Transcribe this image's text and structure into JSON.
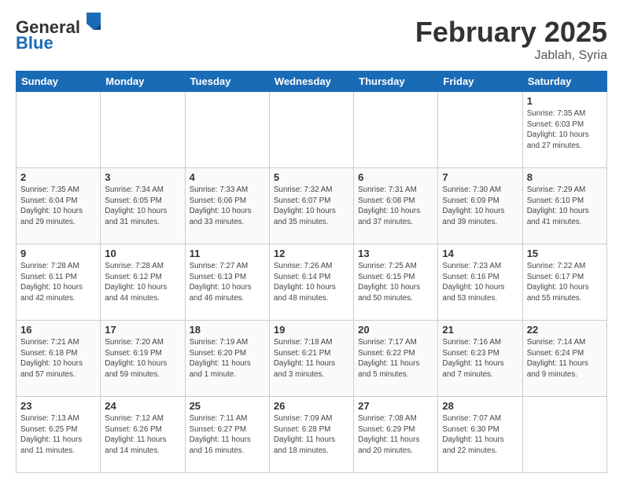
{
  "header": {
    "logo_line1": "General",
    "logo_line2": "Blue",
    "month_year": "February 2025",
    "location": "Jablah, Syria"
  },
  "days_of_week": [
    "Sunday",
    "Monday",
    "Tuesday",
    "Wednesday",
    "Thursday",
    "Friday",
    "Saturday"
  ],
  "weeks": [
    [
      {
        "day": "",
        "info": ""
      },
      {
        "day": "",
        "info": ""
      },
      {
        "day": "",
        "info": ""
      },
      {
        "day": "",
        "info": ""
      },
      {
        "day": "",
        "info": ""
      },
      {
        "day": "",
        "info": ""
      },
      {
        "day": "1",
        "info": "Sunrise: 7:35 AM\nSunset: 6:03 PM\nDaylight: 10 hours\nand 27 minutes."
      }
    ],
    [
      {
        "day": "2",
        "info": "Sunrise: 7:35 AM\nSunset: 6:04 PM\nDaylight: 10 hours\nand 29 minutes."
      },
      {
        "day": "3",
        "info": "Sunrise: 7:34 AM\nSunset: 6:05 PM\nDaylight: 10 hours\nand 31 minutes."
      },
      {
        "day": "4",
        "info": "Sunrise: 7:33 AM\nSunset: 6:06 PM\nDaylight: 10 hours\nand 33 minutes."
      },
      {
        "day": "5",
        "info": "Sunrise: 7:32 AM\nSunset: 6:07 PM\nDaylight: 10 hours\nand 35 minutes."
      },
      {
        "day": "6",
        "info": "Sunrise: 7:31 AM\nSunset: 6:08 PM\nDaylight: 10 hours\nand 37 minutes."
      },
      {
        "day": "7",
        "info": "Sunrise: 7:30 AM\nSunset: 6:09 PM\nDaylight: 10 hours\nand 39 minutes."
      },
      {
        "day": "8",
        "info": "Sunrise: 7:29 AM\nSunset: 6:10 PM\nDaylight: 10 hours\nand 41 minutes."
      }
    ],
    [
      {
        "day": "9",
        "info": "Sunrise: 7:28 AM\nSunset: 6:11 PM\nDaylight: 10 hours\nand 42 minutes."
      },
      {
        "day": "10",
        "info": "Sunrise: 7:28 AM\nSunset: 6:12 PM\nDaylight: 10 hours\nand 44 minutes."
      },
      {
        "day": "11",
        "info": "Sunrise: 7:27 AM\nSunset: 6:13 PM\nDaylight: 10 hours\nand 46 minutes."
      },
      {
        "day": "12",
        "info": "Sunrise: 7:26 AM\nSunset: 6:14 PM\nDaylight: 10 hours\nand 48 minutes."
      },
      {
        "day": "13",
        "info": "Sunrise: 7:25 AM\nSunset: 6:15 PM\nDaylight: 10 hours\nand 50 minutes."
      },
      {
        "day": "14",
        "info": "Sunrise: 7:23 AM\nSunset: 6:16 PM\nDaylight: 10 hours\nand 53 minutes."
      },
      {
        "day": "15",
        "info": "Sunrise: 7:22 AM\nSunset: 6:17 PM\nDaylight: 10 hours\nand 55 minutes."
      }
    ],
    [
      {
        "day": "16",
        "info": "Sunrise: 7:21 AM\nSunset: 6:18 PM\nDaylight: 10 hours\nand 57 minutes."
      },
      {
        "day": "17",
        "info": "Sunrise: 7:20 AM\nSunset: 6:19 PM\nDaylight: 10 hours\nand 59 minutes."
      },
      {
        "day": "18",
        "info": "Sunrise: 7:19 AM\nSunset: 6:20 PM\nDaylight: 11 hours\nand 1 minute."
      },
      {
        "day": "19",
        "info": "Sunrise: 7:18 AM\nSunset: 6:21 PM\nDaylight: 11 hours\nand 3 minutes."
      },
      {
        "day": "20",
        "info": "Sunrise: 7:17 AM\nSunset: 6:22 PM\nDaylight: 11 hours\nand 5 minutes."
      },
      {
        "day": "21",
        "info": "Sunrise: 7:16 AM\nSunset: 6:23 PM\nDaylight: 11 hours\nand 7 minutes."
      },
      {
        "day": "22",
        "info": "Sunrise: 7:14 AM\nSunset: 6:24 PM\nDaylight: 11 hours\nand 9 minutes."
      }
    ],
    [
      {
        "day": "23",
        "info": "Sunrise: 7:13 AM\nSunset: 6:25 PM\nDaylight: 11 hours\nand 11 minutes."
      },
      {
        "day": "24",
        "info": "Sunrise: 7:12 AM\nSunset: 6:26 PM\nDaylight: 11 hours\nand 14 minutes."
      },
      {
        "day": "25",
        "info": "Sunrise: 7:11 AM\nSunset: 6:27 PM\nDaylight: 11 hours\nand 16 minutes."
      },
      {
        "day": "26",
        "info": "Sunrise: 7:09 AM\nSunset: 6:28 PM\nDaylight: 11 hours\nand 18 minutes."
      },
      {
        "day": "27",
        "info": "Sunrise: 7:08 AM\nSunset: 6:29 PM\nDaylight: 11 hours\nand 20 minutes."
      },
      {
        "day": "28",
        "info": "Sunrise: 7:07 AM\nSunset: 6:30 PM\nDaylight: 11 hours\nand 22 minutes."
      },
      {
        "day": "",
        "info": ""
      }
    ]
  ]
}
